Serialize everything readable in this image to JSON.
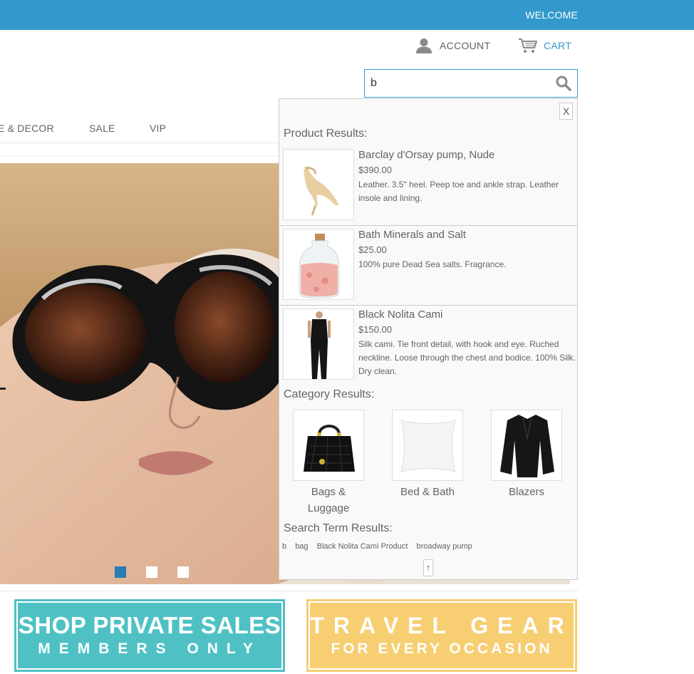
{
  "header": {
    "welcome": "WELCOME",
    "account_label": "ACCOUNT",
    "cart_label": "CART"
  },
  "search": {
    "value": "b",
    "placeholder": ""
  },
  "nav": {
    "items": [
      "E & DECOR",
      "SALE",
      "VIP"
    ]
  },
  "slider": {
    "active_index": 0,
    "count": 3
  },
  "dropdown": {
    "close_label": "X",
    "product_title": "Product Results:",
    "products": [
      {
        "name": "Barclay d'Orsay pump, Nude",
        "price": "$390.00",
        "desc": "Leather. 3.5\" heel. Peep toe and ankle strap. Leather insole and lining."
      },
      {
        "name": "Bath Minerals and Salt",
        "price": "$25.00",
        "desc": "100% pure Dead Sea salts. Fragrance."
      },
      {
        "name": "Black Nolita Cami",
        "price": "$150.00",
        "desc": "Silk cami. Tie front detail, with hook and eye. Ruched neckline. Loose through the chest and bodice. 100% Silk. Dry clean."
      }
    ],
    "category_title": "Category Results:",
    "categories": [
      {
        "label_line1": "Bags &",
        "label_line2": "Luggage"
      },
      {
        "label_line1": "Bed & Bath",
        "label_line2": ""
      },
      {
        "label_line1": "Blazers",
        "label_line2": ""
      }
    ],
    "terms_title": "Search Term Results:",
    "terms": [
      "b",
      "bag",
      "Black Nolita Cami Product",
      "broadway pump"
    ],
    "up_label": "↑"
  },
  "banners": {
    "left": {
      "big": "SHOP PRIVATE SALES",
      "small": "MEMBERS ONLY"
    },
    "right": {
      "big": "TRAVEL GEAR",
      "small": "FOR EVERY OCCASION"
    }
  },
  "colors": {
    "brand_blue": "#3399cc",
    "teal": "#4fc1c4",
    "yellow": "#f7ce72"
  }
}
